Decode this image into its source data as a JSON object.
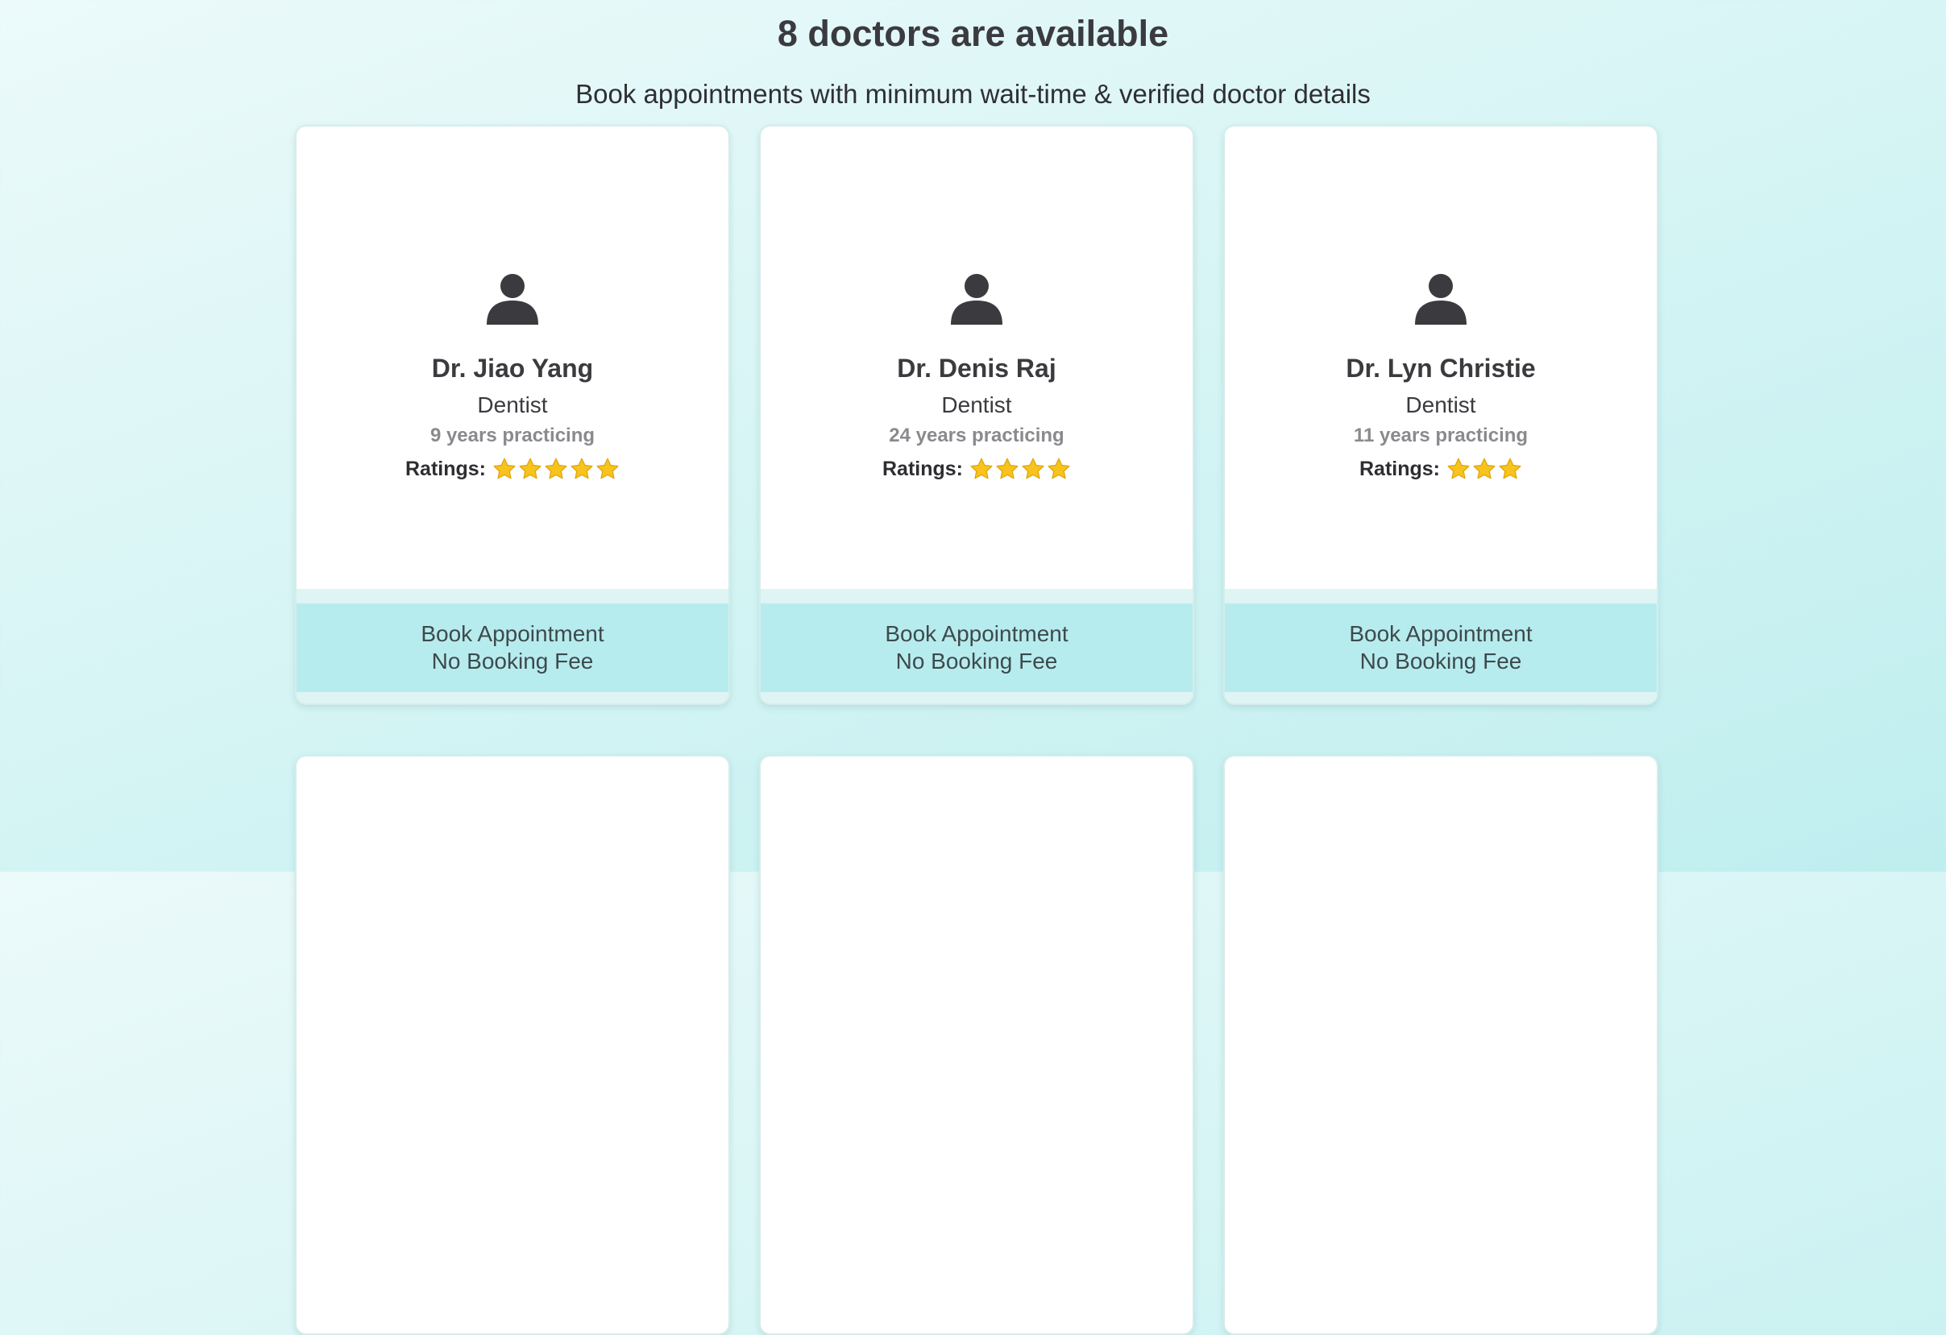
{
  "header": {
    "title": "8 doctors are available",
    "subtitle": "Book appointments with minimum wait-time & verified doctor details"
  },
  "doctors": [
    {
      "name": "Dr. Jiao Yang",
      "specialty": "Dentist",
      "experience": "9 years practicing",
      "ratings_label": "Ratings:",
      "rating": 5,
      "book_label": "Book Appointment",
      "fee_label": "No Booking Fee"
    },
    {
      "name": "Dr. Denis Raj",
      "specialty": "Dentist",
      "experience": "24 years practicing",
      "ratings_label": "Ratings:",
      "rating": 4,
      "book_label": "Book Appointment",
      "fee_label": "No Booking Fee"
    },
    {
      "name": "Dr. Lyn Christie",
      "specialty": "Dentist",
      "experience": "11 years practicing",
      "ratings_label": "Ratings:",
      "rating": 3,
      "book_label": "Book Appointment",
      "fee_label": "No Booking Fee"
    }
  ],
  "icons": {
    "avatar": "user-icon",
    "rating": "star-icon"
  },
  "colors": {
    "button_bg": "#b7ecee",
    "star": "#f7c31c",
    "text": "#3b3b3f"
  }
}
